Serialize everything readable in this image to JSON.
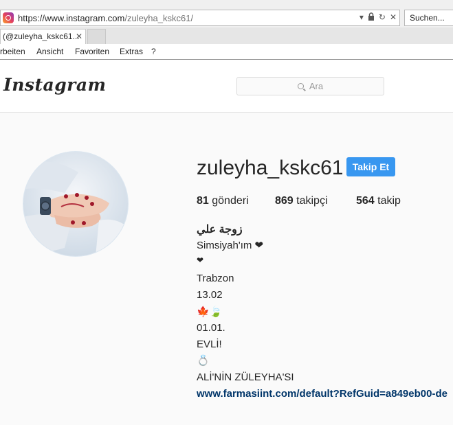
{
  "browser": {
    "url_scheme": "https://",
    "url_host": "www.instagram.com",
    "url_path": "/zuleyha_kskc61/",
    "search_placeholder": "Suchen...",
    "tab_title": "(@zuleyha_kskc61...",
    "tab_close": "✕",
    "icons": [
      "instagram-favicon",
      "dropdown-icon",
      "lock-icon",
      "reload-icon",
      "close-tab-icon"
    ]
  },
  "menu": {
    "items": [
      "rbeiten",
      "Ansicht",
      "Favoriten",
      "Extras",
      "?"
    ]
  },
  "header": {
    "logo": "Instagram",
    "search_placeholder": "Ara"
  },
  "profile": {
    "username": "zuleyha_kskc61",
    "follow_label": "Takip Et",
    "stats": [
      {
        "value": "81",
        "label": "gönderi"
      },
      {
        "value": "869",
        "label": "takipçi"
      },
      {
        "value": "564",
        "label": "takip"
      }
    ],
    "bio_lines": [
      "زوجة علي",
      "Simsiyah'ım ❤",
      "❤",
      "Trabzon",
      "13.02",
      "🍁🍃",
      "01.01.",
      "EVLİ!",
      "💍",
      "ALİ'NİN ZÜLEYHA'SI"
    ],
    "link": "www.farmasiint.com/default?RefGuid=a849eb00-de"
  },
  "colors": {
    "follow_button": "#3897f0",
    "link": "#003569",
    "background": "#fafafa"
  }
}
